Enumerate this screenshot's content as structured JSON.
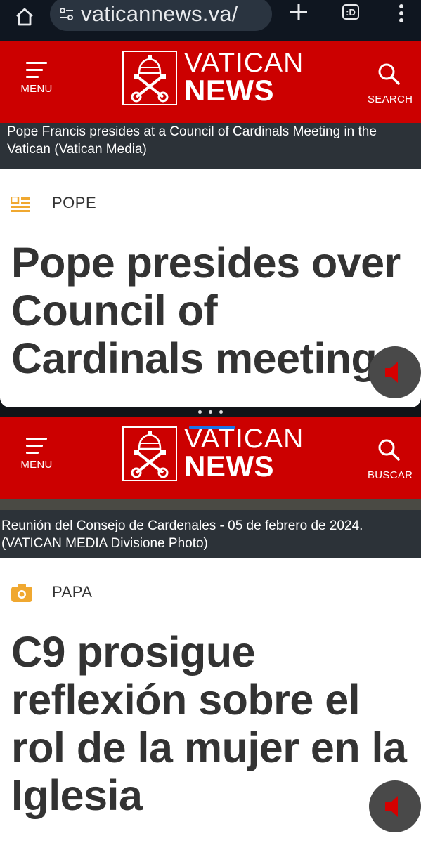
{
  "browser": {
    "url": "vaticannews.va/",
    "tab_count": ":D"
  },
  "panels": [
    {
      "header": {
        "menu_label": "MENU",
        "search_label": "SEARCH",
        "logo_line1": "VATICAN",
        "logo_line2": "NEWS"
      },
      "caption": "Pope Francis presides at a Council of Cardinals Meeting in the Vatican  (Vatican Media)",
      "category": "POPE",
      "category_icon": "article-icon",
      "headline": "Pope presides over Council of Cardinals meeting"
    },
    {
      "header": {
        "menu_label": "MENU",
        "search_label": "BUSCAR",
        "logo_line1": "VATICAN",
        "logo_line2": "NEWS"
      },
      "caption": "Reunión del Consejo de Cardenales - 05 de febrero de 2024. (VATICAN MEDIA Divisione Photo)",
      "category": "PAPA",
      "category_icon": "camera-icon",
      "headline": "C9 prosigue reflexión sobre el rol de la mujer en la Iglesia"
    }
  ],
  "colors": {
    "brand_red": "#cc0000",
    "category_icon": "#f0a830",
    "audio_icon": "#d50000"
  }
}
